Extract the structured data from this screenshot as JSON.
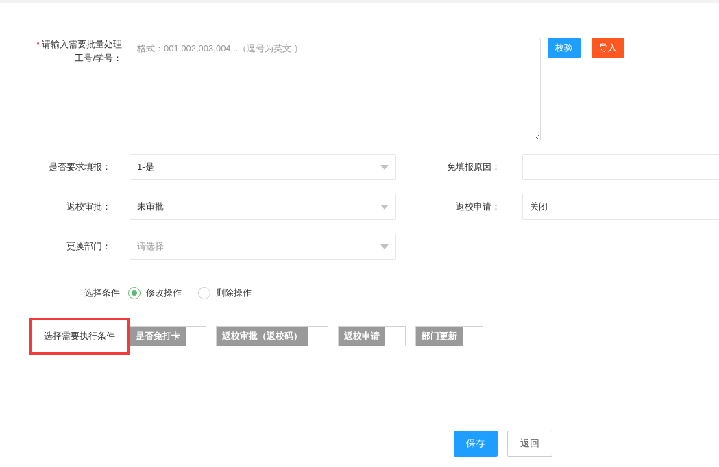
{
  "id_input": {
    "required_mark": "*",
    "label": "请输入需要批量处理工号/学号：",
    "placeholder": "格式：001,002,003,004,..（逗号为英文,）",
    "buttons": [
      {
        "label": "校验",
        "kind": "primary"
      },
      {
        "label": "导入",
        "kind": "warning"
      }
    ]
  },
  "fields": [
    {
      "label": "是否要求填报：",
      "kind": "select",
      "value": "1-是"
    },
    {
      "label": "免填报原因：",
      "kind": "input"
    },
    {
      "label": "返校审批：",
      "kind": "select",
      "value": "未审批"
    },
    {
      "label": "返校申请：",
      "kind": "input",
      "value": "关闭"
    },
    {
      "label": "更换部门：",
      "kind": "select",
      "placeholder": "请选择"
    }
  ],
  "operation": {
    "label": "选择条件",
    "options": [
      {
        "label": "修改操作",
        "selected": true
      },
      {
        "label": "删除操作",
        "selected": false
      }
    ]
  },
  "conditions": {
    "label": "选择需要执行条件",
    "highlighted": true,
    "items": [
      {
        "label": "是否免打卡",
        "checked": false
      },
      {
        "label": "返校审批（返校码）",
        "checked": false
      },
      {
        "label": "返校申请",
        "checked": false
      },
      {
        "label": "部门更新",
        "checked": false
      }
    ]
  },
  "actions": [
    {
      "label": "保存",
      "kind": "primary"
    },
    {
      "label": "返回",
      "kind": "default"
    }
  ]
}
